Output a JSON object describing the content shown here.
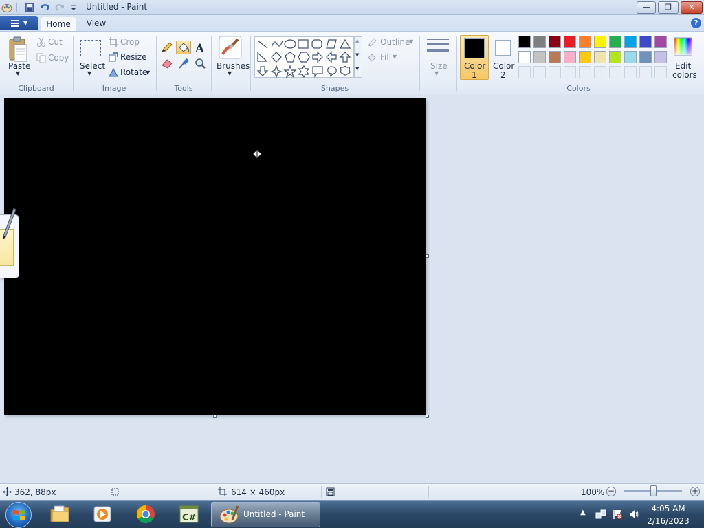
{
  "window": {
    "title": "Untitled - Paint"
  },
  "tabs": [
    {
      "label": "Home",
      "active": true
    },
    {
      "label": "View",
      "active": false
    }
  ],
  "clipboard": {
    "paste": "Paste",
    "cut": "Cut",
    "copy": "Copy",
    "group": "Clipboard"
  },
  "image": {
    "select": "Select",
    "crop": "Crop",
    "resize": "Resize",
    "rotate": "Rotate",
    "group": "Image"
  },
  "tools": {
    "group": "Tools",
    "selected": "fill"
  },
  "brushes": {
    "label": "Brushes"
  },
  "shapes": {
    "outline": "Outline",
    "fill": "Fill",
    "group": "Shapes"
  },
  "size": {
    "label": "Size"
  },
  "colors": {
    "color1_label": "Color",
    "color1_num": "1",
    "color2_label": "Color",
    "color2_num": "2",
    "edit_label": "Edit",
    "edit_label2": "colors",
    "group": "Colors",
    "color1": "#000000",
    "color2": "#ffffff",
    "palette_row1": [
      "#000000",
      "#7f7f7f",
      "#880015",
      "#ed1c24",
      "#ff7f27",
      "#fff200",
      "#22b14c",
      "#00a2e8",
      "#3f48cc",
      "#a349a4"
    ],
    "palette_row2": [
      "#ffffff",
      "#c3c3c3",
      "#b97a57",
      "#ffaec9",
      "#ffc90e",
      "#efe4b0",
      "#b5e61d",
      "#99d9ea",
      "#7092be",
      "#c8bfe7"
    ]
  },
  "canvas": {
    "fill": "#000000"
  },
  "status": {
    "cursor_pos": "362, 88px",
    "canvas_size": "614 × 460px",
    "zoom": "100%"
  },
  "taskbar": {
    "task_label": "Untitled - Paint",
    "time": "4:05 AM",
    "date": "2/16/2023"
  }
}
